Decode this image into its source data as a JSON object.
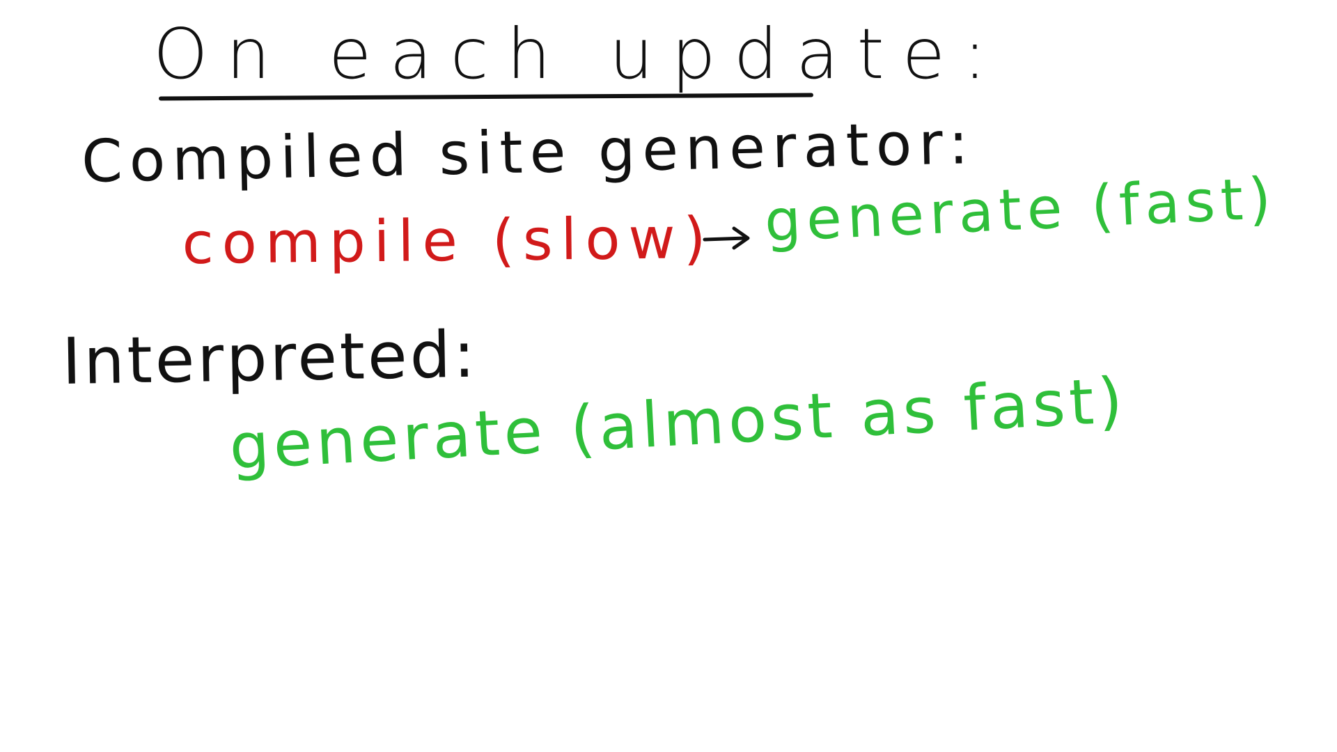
{
  "whiteboard": {
    "title": "On each update:",
    "compiled": {
      "heading": "Compiled site generator:",
      "step_compile": "compile (slow)",
      "step_generate": "generate (fast)"
    },
    "interpreted": {
      "heading": "Interpreted:",
      "step_generate": "generate (almost as fast)"
    }
  },
  "colors": {
    "ink": "#111111",
    "slow": "#d11a1a",
    "fast": "#2fbf3a",
    "background": "#ffffff"
  },
  "icons": {
    "arrow": "arrow-right-icon"
  }
}
